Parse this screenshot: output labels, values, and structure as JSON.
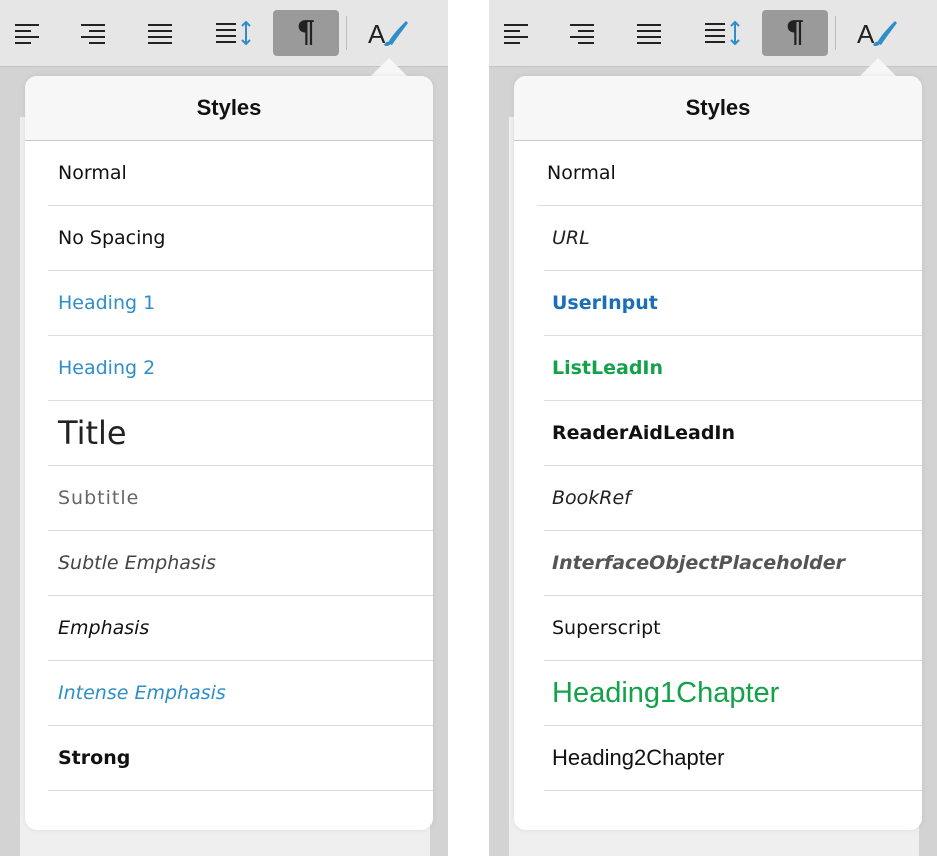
{
  "left_panel": {
    "toolbar": {
      "buttons": [
        "align-left",
        "align-right",
        "justify",
        "line-spacing",
        "paragraph-marks",
        "styles"
      ],
      "active": "paragraph-marks"
    },
    "popover": {
      "title": "Styles",
      "items": [
        "Normal",
        "No Spacing",
        "Heading 1",
        "Heading 2",
        "Title",
        "Subtitle",
        "Subtle Emphasis",
        "Emphasis",
        "Intense Emphasis",
        "Strong"
      ]
    }
  },
  "right_panel": {
    "toolbar": {
      "buttons": [
        "align-left",
        "align-right",
        "justify",
        "line-spacing",
        "paragraph-marks",
        "styles"
      ],
      "active": "paragraph-marks"
    },
    "popover": {
      "title": "Styles",
      "items": [
        "Normal",
        "URL",
        "UserInput",
        "ListLeadIn",
        "ReaderAidLeadIn",
        "BookRef",
        "InterfaceObjectPlaceholder",
        "Superscript",
        "Heading1Chapter",
        "Heading2Chapter"
      ]
    }
  },
  "colors": {
    "heading_blue": "#2e8ec9",
    "userinput_blue": "#1a6fb5",
    "green": "#13a14a",
    "toolbar_bg": "#e6e6e6",
    "active_button": "#9a9a9a"
  },
  "pilcrow_glyph": "¶"
}
